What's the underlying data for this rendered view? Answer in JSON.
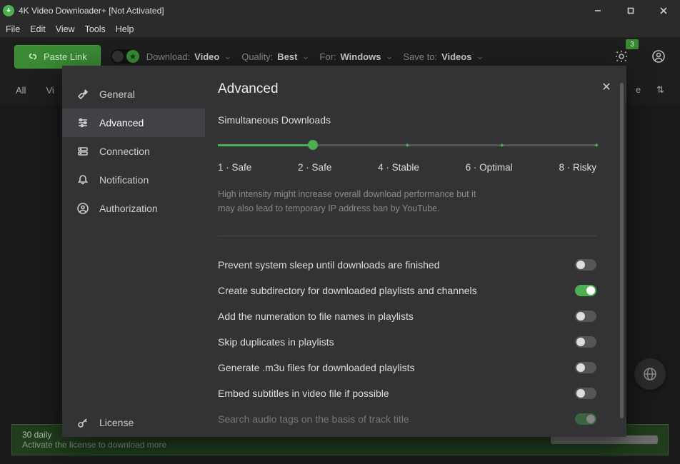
{
  "window": {
    "title": "4K Video Downloader+ [Not Activated]"
  },
  "menubar": [
    "File",
    "Edit",
    "View",
    "Tools",
    "Help"
  ],
  "toolbar": {
    "paste_label": "Paste Link",
    "download_label": "Download:",
    "download_value": "Video",
    "quality_label": "Quality:",
    "quality_value": "Best",
    "for_label": "For:",
    "for_value": "Windows",
    "save_label": "Save to:",
    "save_value": "Videos",
    "notif_count": "3"
  },
  "filters": {
    "left": [
      "All",
      "Vi"
    ],
    "right": [
      "e",
      "↑↓"
    ]
  },
  "banner": {
    "line1": "30 daily",
    "line2": "Activate the license to download more"
  },
  "modal": {
    "title": "Advanced",
    "sidebar": [
      {
        "label": "General",
        "icon": "wrench"
      },
      {
        "label": "Advanced",
        "icon": "sliders",
        "active": true
      },
      {
        "label": "Connection",
        "icon": "server"
      },
      {
        "label": "Notification",
        "icon": "bell"
      },
      {
        "label": "Authorization",
        "icon": "user"
      }
    ],
    "footer_item": {
      "label": "License",
      "icon": "key"
    },
    "simul": {
      "label": "Simultaneous Downloads",
      "ticks": [
        "1 · Safe",
        "2 · Safe",
        "4 · Stable",
        "6 · Optimal",
        "8 · Risky"
      ],
      "value_index": 1,
      "hint": "High intensity might increase overall download performance but it may also lead to temporary IP address ban by YouTube."
    },
    "toggles": [
      {
        "label": "Prevent system sleep until downloads are finished",
        "on": false
      },
      {
        "label": "Create subdirectory for downloaded playlists and channels",
        "on": true
      },
      {
        "label": "Add the numeration to file names in playlists",
        "on": false
      },
      {
        "label": "Skip duplicates in playlists",
        "on": false
      },
      {
        "label": "Generate .m3u files for downloaded playlists",
        "on": false
      },
      {
        "label": "Embed subtitles in video file if possible",
        "on": false
      },
      {
        "label": "Search audio tags on the basis of track title",
        "on": true,
        "faded": true
      }
    ]
  }
}
